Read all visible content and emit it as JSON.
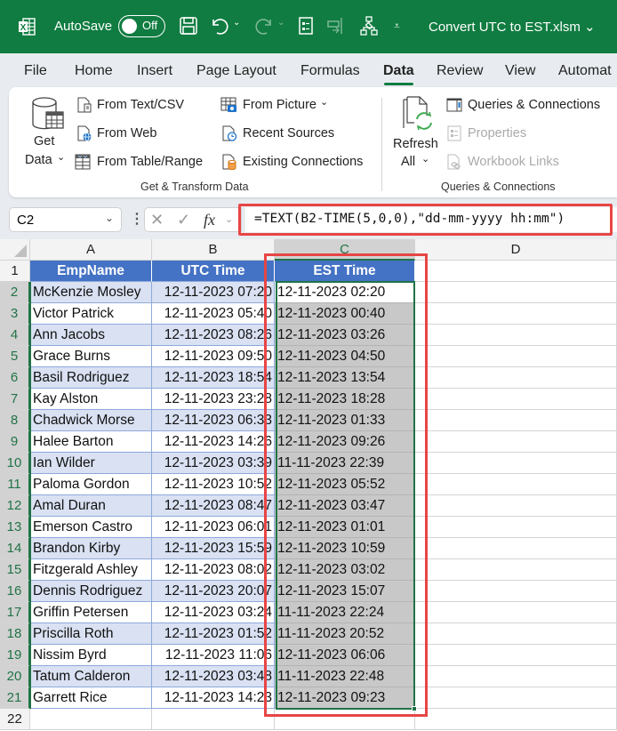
{
  "titlebar": {
    "autosave_label": "AutoSave",
    "autosave_state": "Off",
    "file_name": "Convert UTC to EST.xlsm",
    "bg_color": "#107c41"
  },
  "tabs": [
    {
      "label": "File"
    },
    {
      "label": "Home"
    },
    {
      "label": "Insert"
    },
    {
      "label": "Page Layout"
    },
    {
      "label": "Formulas"
    },
    {
      "label": "Data",
      "active": true
    },
    {
      "label": "Review"
    },
    {
      "label": "View"
    },
    {
      "label": "Automat"
    }
  ],
  "ribbon": {
    "get_data": {
      "line1": "Get",
      "line2": "Data"
    },
    "get_transform": {
      "items": [
        {
          "label": "From Text/CSV"
        },
        {
          "label": "From Web"
        },
        {
          "label": "From Table/Range"
        },
        {
          "label": "From Picture"
        },
        {
          "label": "Recent Sources"
        },
        {
          "label": "Existing Connections"
        }
      ],
      "group_label": "Get & Transform Data"
    },
    "refresh_all": {
      "line1": "Refresh",
      "line2": "All"
    },
    "queries": {
      "items": [
        {
          "label": "Queries & Connections"
        },
        {
          "label": "Properties",
          "disabled": true
        },
        {
          "label": "Workbook Links",
          "disabled": true
        }
      ],
      "group_label": "Queries & Connections"
    }
  },
  "formula_bar": {
    "name_box": "C2",
    "fx": "fx",
    "formula": "=TEXT(B2-TIME(5,0,0),\"dd-mm-yyyy hh:mm\")"
  },
  "sheet": {
    "columns": [
      "A",
      "B",
      "C",
      "D"
    ],
    "row_numbers": [
      "1",
      "2",
      "3",
      "4",
      "5",
      "6",
      "7",
      "8",
      "9",
      "10",
      "11",
      "12",
      "13",
      "14",
      "15",
      "16",
      "17",
      "18",
      "19",
      "20",
      "21",
      "22"
    ],
    "headers": [
      "EmpName",
      "UTC Time",
      "EST Time"
    ],
    "rows": [
      [
        "McKenzie Mosley",
        "12-11-2023 07:20",
        "12-11-2023 02:20"
      ],
      [
        "Victor Patrick",
        "12-11-2023 05:40",
        "12-11-2023 00:40"
      ],
      [
        "Ann Jacobs",
        "12-11-2023 08:26",
        "12-11-2023 03:26"
      ],
      [
        "Grace Burns",
        "12-11-2023 09:50",
        "12-11-2023 04:50"
      ],
      [
        "Basil Rodriguez",
        "12-11-2023 18:54",
        "12-11-2023 13:54"
      ],
      [
        "Kay Alston",
        "12-11-2023 23:28",
        "12-11-2023 18:28"
      ],
      [
        "Chadwick Morse",
        "12-11-2023 06:33",
        "12-11-2023 01:33"
      ],
      [
        "Halee Barton",
        "12-11-2023 14:26",
        "12-11-2023 09:26"
      ],
      [
        "Ian Wilder",
        "12-11-2023 03:39",
        "11-11-2023 22:39"
      ],
      [
        "Paloma Gordon",
        "12-11-2023 10:52",
        "12-11-2023 05:52"
      ],
      [
        "Amal Duran",
        "12-11-2023 08:47",
        "12-11-2023 03:47"
      ],
      [
        "Emerson Castro",
        "12-11-2023 06:01",
        "12-11-2023 01:01"
      ],
      [
        "Brandon Kirby",
        "12-11-2023 15:59",
        "12-11-2023 10:59"
      ],
      [
        "Fitzgerald Ashley",
        "12-11-2023 08:02",
        "12-11-2023 03:02"
      ],
      [
        "Dennis Rodriguez",
        "12-11-2023 20:07",
        "12-11-2023 15:07"
      ],
      [
        "Griffin Petersen",
        "12-11-2023 03:24",
        "11-11-2023 22:24"
      ],
      [
        "Priscilla Roth",
        "12-11-2023 01:52",
        "11-11-2023 20:52"
      ],
      [
        "Nissim Byrd",
        "12-11-2023 11:06",
        "12-11-2023 06:06"
      ],
      [
        "Tatum Calderon",
        "12-11-2023 03:48",
        "11-11-2023 22:48"
      ],
      [
        "Garrett Rice",
        "12-11-2023 14:23",
        "12-11-2023 09:23"
      ]
    ],
    "colors": {
      "header_bg": "#4472c4",
      "band_bg": "#d9e1f2",
      "selection": "#217346",
      "highlight": "#e84545"
    }
  }
}
